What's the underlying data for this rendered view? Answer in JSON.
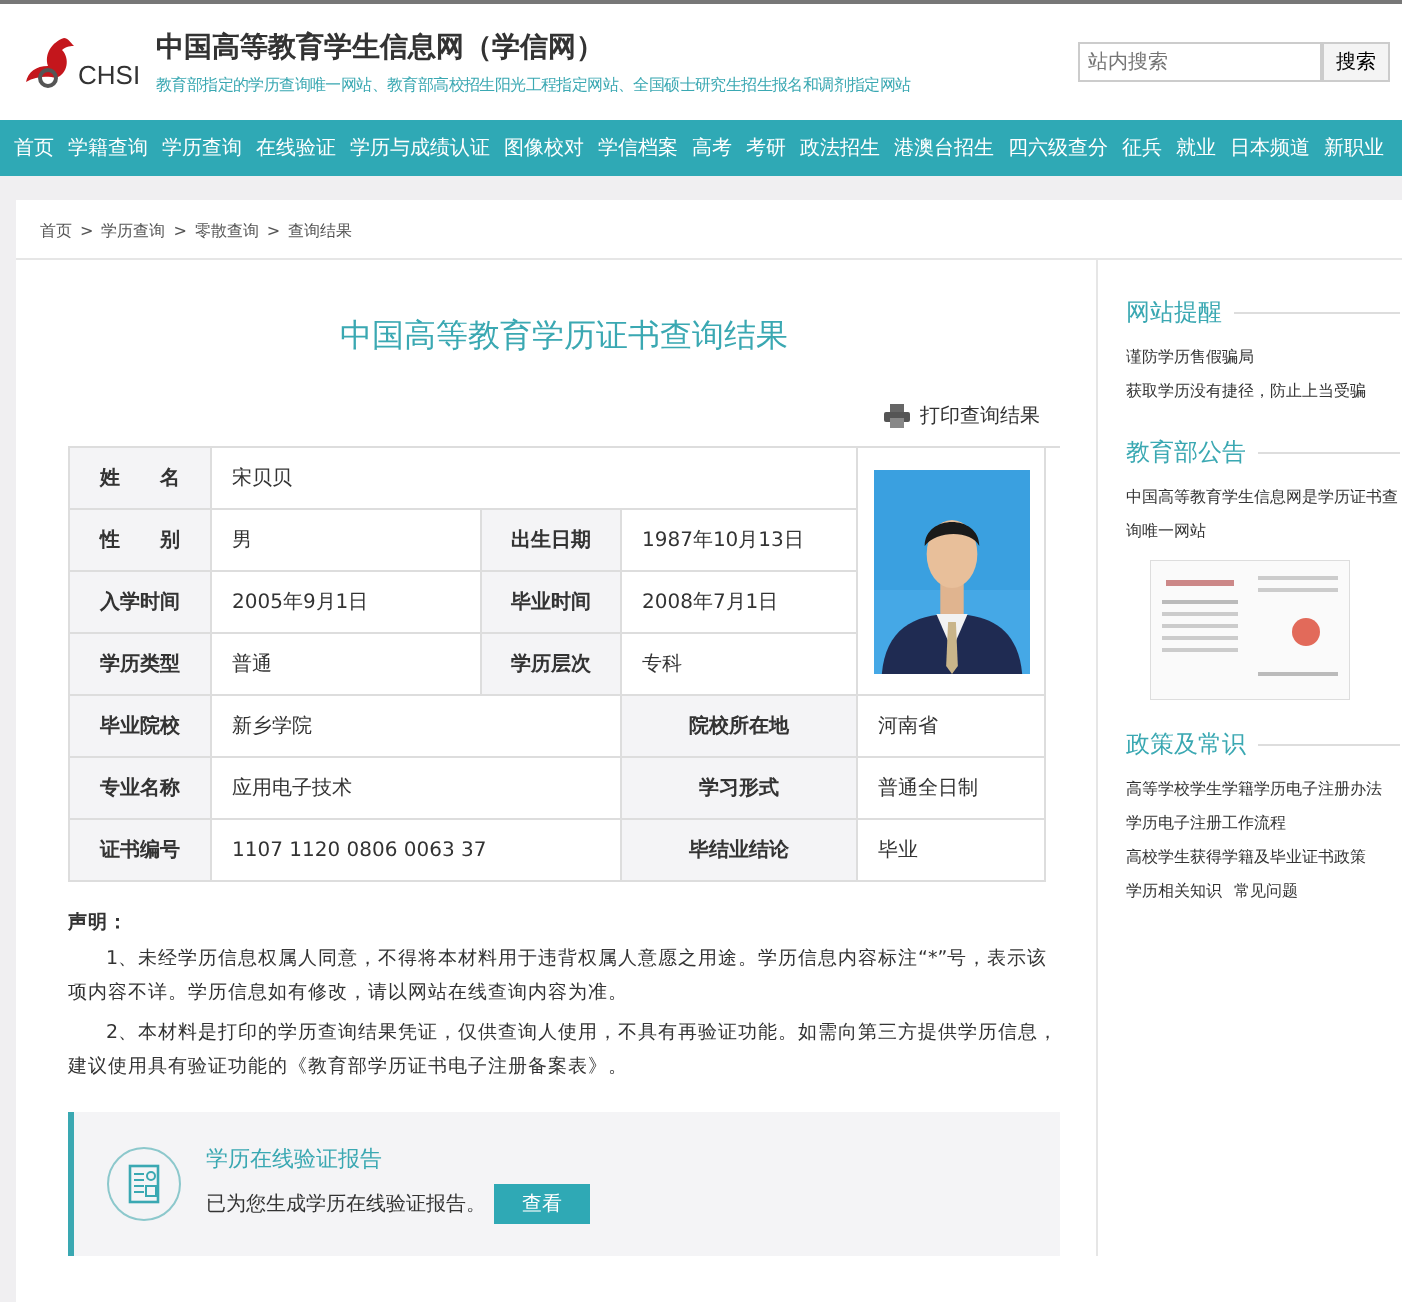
{
  "header": {
    "logo_text": "CHSI",
    "site_title": "中国高等教育学生信息网（学信网）",
    "tagline": "教育部指定的学历查询唯一网站、教育部高校招生阳光工程指定网站、全国硕士研究生招生报名和调剂指定网站",
    "search": {
      "placeholder": "站内搜索",
      "button": "搜索"
    }
  },
  "nav": [
    "首页",
    "学籍查询",
    "学历查询",
    "在线验证",
    "学历与成绩认证",
    "图像校对",
    "学信档案",
    "高考",
    "考研",
    "政法招生",
    "港澳台招生",
    "四六级查分",
    "征兵",
    "就业",
    "日本频道",
    "新职业"
  ],
  "breadcrumb": [
    "首页",
    "学历查询",
    "零散查询",
    "查询结果"
  ],
  "breadcrumb_separator": ">",
  "title": "中国高等教育学历证书查询结果",
  "print_link": "打印查询结果",
  "record": {
    "photo": {
      "kind": "picture"
    },
    "rows": [
      {
        "cells": [
          {
            "label": "姓　　名",
            "value": "宋贝贝"
          }
        ]
      },
      {
        "cells": [
          {
            "label": "性　　别",
            "value": "男"
          },
          {
            "label": "出生日期",
            "value": "1987年10月13日"
          }
        ]
      },
      {
        "cells": [
          {
            "label": "入学时间",
            "value": "2005年9月1日"
          },
          {
            "label": "毕业时间",
            "value": "2008年7月1日"
          }
        ]
      },
      {
        "cells": [
          {
            "label": "学历类型",
            "value": "普通"
          },
          {
            "label": "学历层次",
            "value": "专科"
          }
        ]
      },
      {
        "cells": [
          {
            "label": "毕业院校",
            "value": "新乡学院"
          },
          {
            "label": "院校所在地",
            "value": "河南省"
          }
        ]
      },
      {
        "cells": [
          {
            "label": "专业名称",
            "value": "应用电子技术"
          },
          {
            "label": "学习形式",
            "value": "普通全日制"
          }
        ]
      },
      {
        "cells": [
          {
            "label": "证书编号",
            "value": "1107 1120 0806 0063 37"
          },
          {
            "label": "毕结业结论",
            "value": "毕业"
          }
        ]
      }
    ]
  },
  "statement": {
    "heading": "声明：",
    "paragraphs": [
      "1、未经学历信息权属人同意，不得将本材料用于违背权属人意愿之用途。学历信息内容标注“*”号，表示该项内容不详。学历信息如有修改，请以网站在线查询内容为准。",
      "2、本材料是打印的学历查询结果凭证，仅供查询人使用，不具有再验证功能。如需向第三方提供学历信息，建议使用具有验证功能的《教育部学历证书电子注册备案表》。"
    ]
  },
  "report": {
    "title": "学历在线验证报告",
    "text": "已为您生成学历在线验证报告。",
    "button": "查看"
  },
  "sidebar": [
    {
      "heading": "网站提醒",
      "links": [
        "谨防学历售假骗局",
        "获取学历没有捷径，防止上当受骗"
      ]
    },
    {
      "heading": "教育部公告",
      "links": [
        "中国高等教育学生信息网是学历证书查询唯一网站"
      ],
      "image": {
        "kind": "picture"
      }
    },
    {
      "heading": "政策及常识",
      "links": [
        "高等学校学生学籍学历电子注册办法",
        "学历电子注册工作流程",
        "高校学生获得学籍及毕业证书政策"
      ],
      "inline_links": [
        "学历相关知识",
        "常见问题"
      ]
    }
  ]
}
